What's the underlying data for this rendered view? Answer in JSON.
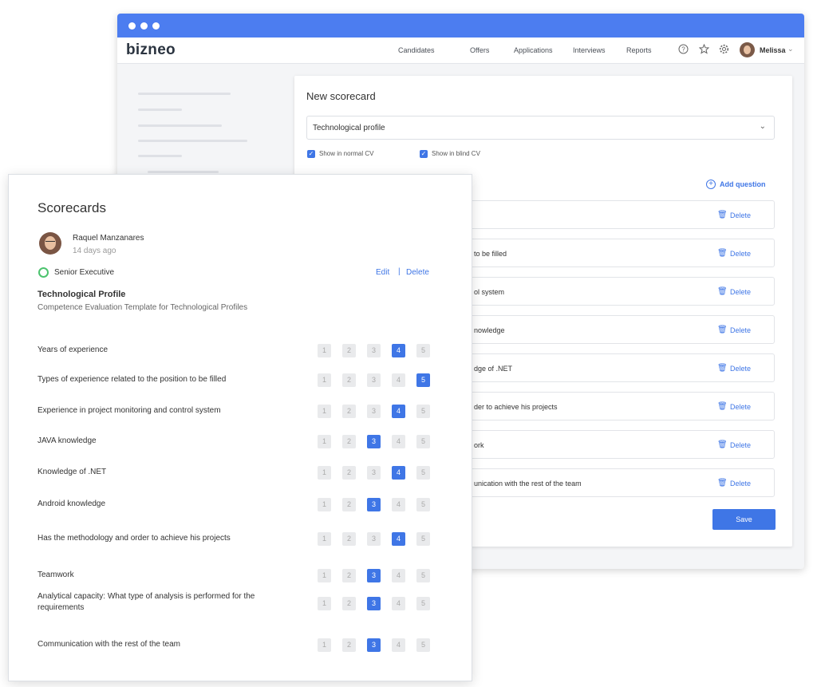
{
  "brand": {
    "logo": "bizneo"
  },
  "nav": {
    "items": [
      "Candidates",
      "Offers",
      "Applications",
      "Interviews",
      "Reports"
    ],
    "user_name": "Melissa"
  },
  "colors": {
    "accent": "#3f76e6",
    "titlebar": "#4c7df0",
    "status_ring": "#4cc36e"
  },
  "editor": {
    "title": "New scorecard",
    "template_select": "Technological profile",
    "checkbox_normal_cv": "Show in normal CV",
    "checkbox_blind_cv": "Show in blind CV",
    "add_question": "Add question",
    "delete_label": "Delete",
    "save_label": "Save",
    "rows": [
      "",
      "to be filled",
      "ol system",
      "nowledge",
      "dge of .NET",
      "der to achieve his projects",
      "ork",
      "unication with the rest of the team"
    ]
  },
  "scorecard": {
    "title": "Scorecards",
    "reviewer_name": "Raquel Manzanares",
    "reviewed_time": "14 days ago",
    "level": "Senior Executive",
    "edit_label": "Edit",
    "separator": "|",
    "delete_label": "Delete",
    "profile_title": "Technological Profile",
    "profile_desc": "Competence Evaluation Template for Technological Profiles",
    "score_labels": [
      "1",
      "2",
      "3",
      "4",
      "5"
    ],
    "criteria": [
      {
        "label": "Years of experience",
        "score": 4
      },
      {
        "label": "Types of experience related to the position to be filled",
        "score": 5
      },
      {
        "label": "Experience in project monitoring and control system",
        "score": 4
      },
      {
        "label": "JAVA knowledge",
        "score": 3
      },
      {
        "label": "Knowledge of .NET",
        "score": 4
      },
      {
        "label": "Android knowledge",
        "score": 3
      },
      {
        "label": "Has the methodology and order to achieve his projects",
        "score": 4
      },
      {
        "label": "Teamwork",
        "score": 3
      },
      {
        "label": "Analytical capacity: What type of analysis is performed for the requirements",
        "score": 3
      },
      {
        "label": "Communication with the rest of the team",
        "score": 3
      }
    ]
  }
}
